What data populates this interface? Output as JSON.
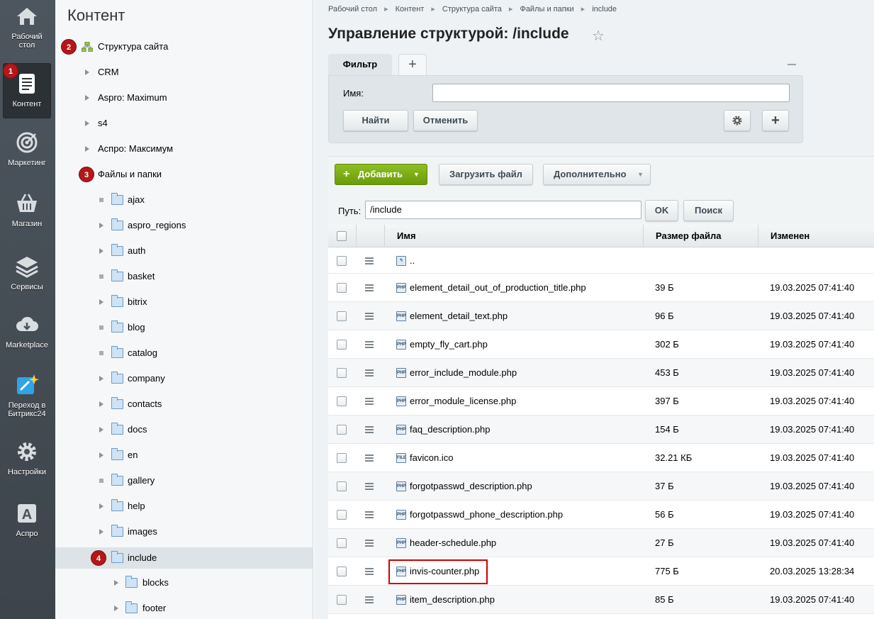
{
  "nav": {
    "items": [
      {
        "label": "Рабочий стол",
        "icon": "home-icon"
      },
      {
        "label": "Контент",
        "icon": "document-icon",
        "active": true
      },
      {
        "label": "Маркетинг",
        "icon": "target-icon"
      },
      {
        "label": "Магазин",
        "icon": "basket-icon"
      },
      {
        "label": "Сервисы",
        "icon": "layers-icon"
      },
      {
        "label": "Marketplace",
        "icon": "cloud-download-icon"
      },
      {
        "label": "Переход в Битрикс24",
        "icon": "bitrix24-icon"
      },
      {
        "label": "Настройки",
        "icon": "gear-icon"
      },
      {
        "label": "Аспро",
        "icon": "aspro-icon"
      }
    ]
  },
  "badges": [
    "1",
    "2",
    "3",
    "4"
  ],
  "tree": {
    "title": "Контент",
    "root": "Структура сайта",
    "sites": [
      "CRM",
      "Aspro: Maximum",
      "s4",
      "Аспро: Максимум"
    ],
    "files_root": "Файлы и папки",
    "folders": [
      "ajax",
      "aspro_regions",
      "auth",
      "basket",
      "bitrix",
      "blog",
      "catalog",
      "company",
      "contacts",
      "docs",
      "en",
      "gallery",
      "help",
      "images",
      "include"
    ],
    "subfolders": [
      "blocks",
      "footer"
    ]
  },
  "breadcrumb": [
    "Рабочий стол",
    "Контент",
    "Структура сайта",
    "Файлы и папки",
    "include"
  ],
  "page_title": "Управление структурой: /include",
  "filter": {
    "tab_label": "Фильтр",
    "add_tab": "+",
    "name_label": "Имя:",
    "name_value": "",
    "find_label": "Найти",
    "cancel_label": "Отменить"
  },
  "toolbar": {
    "add_label": "Добавить",
    "upload_label": "Загрузить файл",
    "more_label": "Дополнительно"
  },
  "path": {
    "label": "Путь:",
    "value": "/include",
    "ok_label": "OK",
    "search_label": "Поиск"
  },
  "grid": {
    "columns": [
      "Имя",
      "Размер файла",
      "Изменен"
    ],
    "up_label": "..",
    "rows": [
      {
        "name": "element_detail_out_of_production_title.php",
        "size": "39 Б",
        "modified": "19.03.2025 07:41:40",
        "type": "PHP"
      },
      {
        "name": "element_detail_text.php",
        "size": "96 Б",
        "modified": "19.03.2025 07:41:40",
        "type": "PHP"
      },
      {
        "name": "empty_fly_cart.php",
        "size": "302 Б",
        "modified": "19.03.2025 07:41:40",
        "type": "PHP"
      },
      {
        "name": "error_include_module.php",
        "size": "453 Б",
        "modified": "19.03.2025 07:41:40",
        "type": "PHP"
      },
      {
        "name": "error_module_license.php",
        "size": "397 Б",
        "modified": "19.03.2025 07:41:40",
        "type": "PHP"
      },
      {
        "name": "faq_description.php",
        "size": "154 Б",
        "modified": "19.03.2025 07:41:40",
        "type": "PHP"
      },
      {
        "name": "favicon.ico",
        "size": "32.21 КБ",
        "modified": "19.03.2025 07:41:40",
        "type": "FILE"
      },
      {
        "name": "forgotpasswd_description.php",
        "size": "37 Б",
        "modified": "19.03.2025 07:41:40",
        "type": "PHP"
      },
      {
        "name": "forgotpasswd_phone_description.php",
        "size": "56 Б",
        "modified": "19.03.2025 07:41:40",
        "type": "PHP"
      },
      {
        "name": "header-schedule.php",
        "size": "27 Б",
        "modified": "19.03.2025 07:41:40",
        "type": "PHP"
      },
      {
        "name": "invis-counter.php",
        "size": "775 Б",
        "modified": "20.03.2025 13:28:34",
        "type": "PHP"
      },
      {
        "name": "item_description.php",
        "size": "85 Б",
        "modified": "19.03.2025 07:41:40",
        "type": "PHP"
      }
    ]
  },
  "colors": {
    "accent_green": "#7aac14",
    "annotation_red": "#b51718",
    "nav_bg": "#454d55"
  }
}
